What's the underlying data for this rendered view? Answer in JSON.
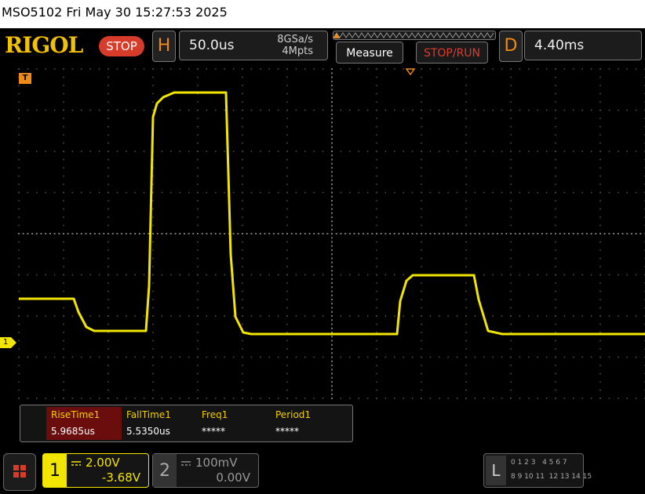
{
  "header": {
    "title_line": "MSO5102  Fri May 30 15:27:53 2025",
    "brand": "RIGOL",
    "run_state": "STOP"
  },
  "horizontal": {
    "letter": "H",
    "timebase": "50.0us",
    "sample_rate": "8GSa/s",
    "memory_depth": "4Mpts"
  },
  "toolbar": {
    "measure_label": "Measure",
    "stop_run_label": "STOP/RUN"
  },
  "delay": {
    "letter": "D",
    "value": "4.40ms"
  },
  "markers": {
    "trigger_marker": "T",
    "channel1_marker": "1"
  },
  "measurements": [
    {
      "label": "RiseTime1",
      "value": "5.9685us"
    },
    {
      "label": "FallTime1",
      "value": "5.5350us"
    },
    {
      "label": "Freq1",
      "value": "*****"
    },
    {
      "label": "Period1",
      "value": "*****"
    }
  ],
  "channels": [
    {
      "number": "1",
      "scale": "2.00V",
      "offset": "-3.68V",
      "color": "#f2e600",
      "active": true
    },
    {
      "number": "2",
      "scale": "100mV",
      "offset": "0.00V",
      "color": "#888888",
      "active": false
    }
  ],
  "logic": {
    "letter": "L",
    "row1": "0 1 2 3   4 5 6 7",
    "row2": "8 9 10 11  12 13 14 15"
  },
  "colors": {
    "trace": "#f2e600",
    "accent_orange": "#f08a16",
    "stop_red": "#d73b2a",
    "brand_gold": "#f2c200"
  }
}
